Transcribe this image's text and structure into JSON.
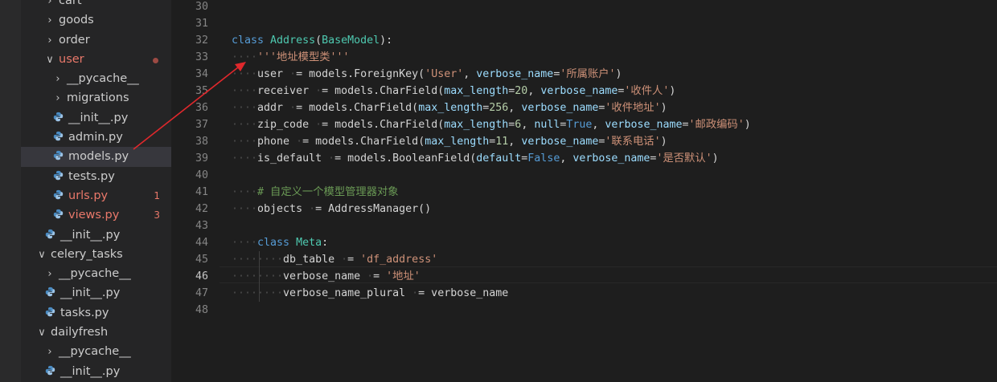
{
  "sidebar": {
    "items": [
      {
        "label": "cart",
        "indent": 1,
        "icon": "chevron-right",
        "state": ""
      },
      {
        "label": "goods",
        "indent": 1,
        "icon": "chevron-right",
        "state": ""
      },
      {
        "label": "order",
        "indent": 1,
        "icon": "chevron-right",
        "state": ""
      },
      {
        "label": "user",
        "indent": 1,
        "icon": "chevron-down",
        "state": "err",
        "dot": true
      },
      {
        "label": "__pycache__",
        "indent": 2,
        "icon": "chevron-right",
        "state": ""
      },
      {
        "label": "migrations",
        "indent": 2,
        "icon": "chevron-right",
        "state": ""
      },
      {
        "label": "__init__.py",
        "indent": 2,
        "icon": "python",
        "state": ""
      },
      {
        "label": "admin.py",
        "indent": 2,
        "icon": "python",
        "state": ""
      },
      {
        "label": "models.py",
        "indent": 2,
        "icon": "python",
        "state": "selected"
      },
      {
        "label": "tests.py",
        "indent": 2,
        "icon": "python",
        "state": ""
      },
      {
        "label": "urls.py",
        "indent": 2,
        "icon": "python",
        "state": "err",
        "badge": "1"
      },
      {
        "label": "views.py",
        "indent": 2,
        "icon": "python",
        "state": "err",
        "badge": "3"
      },
      {
        "label": "__init__.py",
        "indent": 1,
        "icon": "python",
        "state": ""
      },
      {
        "label": "celery_tasks",
        "indent": 0,
        "icon": "chevron-down",
        "state": ""
      },
      {
        "label": "__pycache__",
        "indent": 1,
        "icon": "chevron-right",
        "state": ""
      },
      {
        "label": "__init__.py",
        "indent": 1,
        "icon": "python",
        "state": ""
      },
      {
        "label": "tasks.py",
        "indent": 1,
        "icon": "python",
        "state": ""
      },
      {
        "label": "dailyfresh",
        "indent": 0,
        "icon": "chevron-down",
        "state": ""
      },
      {
        "label": "__pycache__",
        "indent": 1,
        "icon": "chevron-right",
        "state": ""
      },
      {
        "label": "__init__.py",
        "indent": 1,
        "icon": "python",
        "state": ""
      }
    ]
  },
  "editor": {
    "current_line": 46,
    "colors": {
      "keyword": "#569cd6",
      "class": "#4ec9b0",
      "string": "#ce9178",
      "param": "#9cdcfe",
      "number": "#b5cea8",
      "comment": "#6a9955",
      "arrow": "#e0282c"
    },
    "lines": [
      {
        "n": "30",
        "tokens": []
      },
      {
        "n": "31",
        "tokens": []
      },
      {
        "n": "32",
        "tokens": [
          [
            "kw",
            "class "
          ],
          [
            "cls",
            "Address"
          ],
          [
            "",
            "("
          ],
          [
            "cls",
            "BaseModel"
          ],
          [
            "",
            "):"
          ]
        ]
      },
      {
        "n": "33",
        "tokens": [
          [
            "ws",
            "····"
          ],
          [
            "str",
            "'''地址模型类'''"
          ]
        ]
      },
      {
        "n": "34",
        "tokens": [
          [
            "ws",
            "····"
          ],
          [
            "",
            "user "
          ],
          [
            "ws",
            "·"
          ],
          [
            "",
            "= models.ForeignKey("
          ],
          [
            "str",
            "'User'"
          ],
          [
            "",
            ", "
          ],
          [
            "prm",
            "verbose_name"
          ],
          [
            "",
            "="
          ],
          [
            "str",
            "'所属账户'"
          ],
          [
            "",
            ")"
          ]
        ]
      },
      {
        "n": "35",
        "tokens": [
          [
            "ws",
            "····"
          ],
          [
            "",
            "receiver "
          ],
          [
            "ws",
            "·"
          ],
          [
            "",
            "= models.CharField("
          ],
          [
            "prm",
            "max_length"
          ],
          [
            "",
            "="
          ],
          [
            "num",
            "20"
          ],
          [
            "",
            ", "
          ],
          [
            "prm",
            "verbose_name"
          ],
          [
            "",
            "="
          ],
          [
            "str",
            "'收件人'"
          ],
          [
            "",
            ")"
          ]
        ]
      },
      {
        "n": "36",
        "tokens": [
          [
            "ws",
            "····"
          ],
          [
            "",
            "addr "
          ],
          [
            "ws",
            "·"
          ],
          [
            "",
            "= models.CharField("
          ],
          [
            "prm",
            "max_length"
          ],
          [
            "",
            "="
          ],
          [
            "num",
            "256"
          ],
          [
            "",
            ", "
          ],
          [
            "prm",
            "verbose_name"
          ],
          [
            "",
            "="
          ],
          [
            "str",
            "'收件地址'"
          ],
          [
            "",
            ")"
          ]
        ]
      },
      {
        "n": "37",
        "tokens": [
          [
            "ws",
            "····"
          ],
          [
            "",
            "zip_code "
          ],
          [
            "ws",
            "·"
          ],
          [
            "",
            "= models.CharField("
          ],
          [
            "prm",
            "max_length"
          ],
          [
            "",
            "="
          ],
          [
            "num",
            "6"
          ],
          [
            "",
            ", "
          ],
          [
            "prm",
            "null"
          ],
          [
            "",
            "="
          ],
          [
            "kw",
            "True"
          ],
          [
            "",
            ", "
          ],
          [
            "prm",
            "verbose_name"
          ],
          [
            "",
            "="
          ],
          [
            "str",
            "'邮政编码'"
          ],
          [
            "",
            ")"
          ]
        ]
      },
      {
        "n": "38",
        "tokens": [
          [
            "ws",
            "····"
          ],
          [
            "",
            "phone "
          ],
          [
            "ws",
            "·"
          ],
          [
            "",
            "= models.CharField("
          ],
          [
            "prm",
            "max_length"
          ],
          [
            "",
            "="
          ],
          [
            "num",
            "11"
          ],
          [
            "",
            ", "
          ],
          [
            "prm",
            "verbose_name"
          ],
          [
            "",
            "="
          ],
          [
            "str",
            "'联系电话'"
          ],
          [
            "",
            ")"
          ]
        ]
      },
      {
        "n": "39",
        "tokens": [
          [
            "ws",
            "····"
          ],
          [
            "",
            "is_default "
          ],
          [
            "ws",
            "·"
          ],
          [
            "",
            "= models.BooleanField("
          ],
          [
            "prm",
            "default"
          ],
          [
            "",
            "="
          ],
          [
            "kw",
            "False"
          ],
          [
            "",
            ", "
          ],
          [
            "prm",
            "verbose_name"
          ],
          [
            "",
            "="
          ],
          [
            "str",
            "'是否默认'"
          ],
          [
            "",
            ")"
          ]
        ]
      },
      {
        "n": "40",
        "tokens": []
      },
      {
        "n": "41",
        "tokens": [
          [
            "ws",
            "····"
          ],
          [
            "cmt",
            "# 自定义一个模型管理器对象"
          ]
        ]
      },
      {
        "n": "42",
        "tokens": [
          [
            "ws",
            "····"
          ],
          [
            "",
            "objects "
          ],
          [
            "ws",
            "·"
          ],
          [
            "",
            "= AddressManager()"
          ]
        ]
      },
      {
        "n": "43",
        "tokens": []
      },
      {
        "n": "44",
        "tokens": [
          [
            "ws",
            "····"
          ],
          [
            "kw",
            "class "
          ],
          [
            "cls",
            "Meta"
          ],
          [
            "",
            ":"
          ]
        ]
      },
      {
        "n": "45",
        "tokens": [
          [
            "ws",
            "········"
          ],
          [
            "",
            "db_table "
          ],
          [
            "ws",
            "·"
          ],
          [
            "",
            "= "
          ],
          [
            "str",
            "'df_address'"
          ]
        ]
      },
      {
        "n": "46",
        "tokens": [
          [
            "ws",
            "········"
          ],
          [
            "",
            "verbose_name "
          ],
          [
            "ws",
            "·"
          ],
          [
            "",
            "= "
          ],
          [
            "str",
            "'地址'"
          ]
        ]
      },
      {
        "n": "47",
        "tokens": [
          [
            "ws",
            "········"
          ],
          [
            "",
            "verbose_name_plural "
          ],
          [
            "ws",
            "·"
          ],
          [
            "",
            "= verbose_name"
          ]
        ]
      },
      {
        "n": "48",
        "tokens": []
      }
    ]
  }
}
